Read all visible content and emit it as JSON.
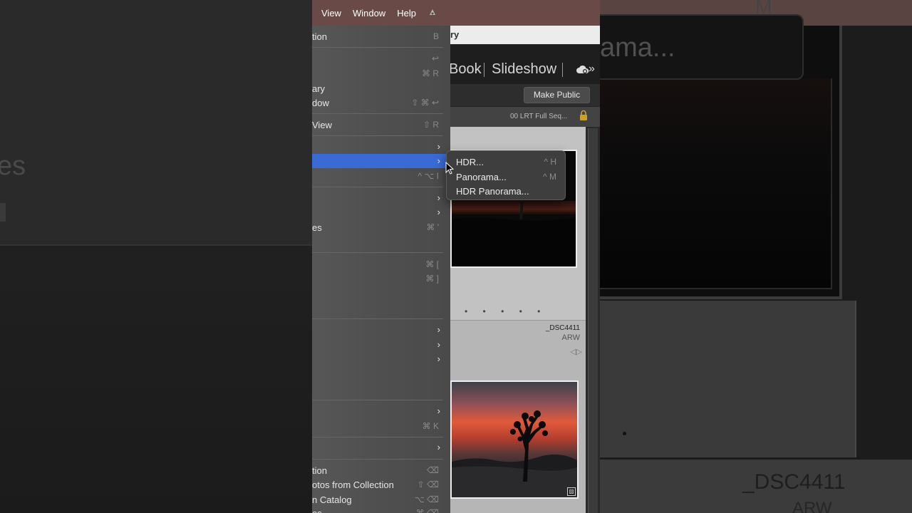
{
  "menubar": {
    "items": [
      "View",
      "Window",
      "Help"
    ]
  },
  "window": {
    "title_fragment": "ry"
  },
  "modules": [
    "Book",
    "Slideshow"
  ],
  "toolbar": {
    "make_public_label": "Make Public"
  },
  "filter": {
    "preset_label": "00 LRT Full Seq..."
  },
  "photo_menu": {
    "items": [
      {
        "label": "tion",
        "shortcut": "B"
      },
      {
        "label": "",
        "shortcut": "↩"
      },
      {
        "label": "",
        "shortcut": "⌘ R"
      },
      {
        "label": "ary",
        "shortcut": ""
      },
      {
        "label": "dow",
        "shortcut": "⇧ ⌘ ↩"
      },
      {
        "label": "View",
        "shortcut": "⇧ R"
      },
      {
        "label": "",
        "shortcut": "^ ⌥ I"
      },
      {
        "label": "es",
        "shortcut": "⌘ '"
      },
      {
        "label": "",
        "shortcut": "⌘ ["
      },
      {
        "label": "",
        "shortcut": "⌘ ]"
      },
      {
        "label": "",
        "shortcut": "⌘ K"
      },
      {
        "label": "tion",
        "shortcut": "⌫"
      },
      {
        "label": "otos from Collection",
        "shortcut": "⇧ ⌫"
      },
      {
        "label": "n Catalog",
        "shortcut": "⌥ ⌫"
      },
      {
        "label": "es",
        "shortcut": "⌘ ⌫"
      }
    ]
  },
  "photo_merge_submenu": {
    "items": [
      {
        "label": "HDR...",
        "shortcut": "^ H"
      },
      {
        "label": "Panorama...",
        "shortcut": "^ M"
      },
      {
        "label": "HDR Panorama...",
        "shortcut": ""
      }
    ]
  },
  "grid": {
    "cell2_filename": "_DSC4411",
    "cell2_ext": "ARW",
    "dots": "• • • • •"
  },
  "background": {
    "left_ghost": "es",
    "right_ghost_pano": "ama...",
    "right_ghost_m": "M",
    "right_ghost_dsc": "_DSC4411",
    "right_ghost_arw": "ARW"
  },
  "icons": {
    "cloud": "cloud-sync-icon",
    "lock": "lock-icon",
    "chevron": "chevron-right-icon"
  },
  "colors": {
    "menu_highlight": "#3a6bd4",
    "mac_menubar": "#6a4a47"
  }
}
